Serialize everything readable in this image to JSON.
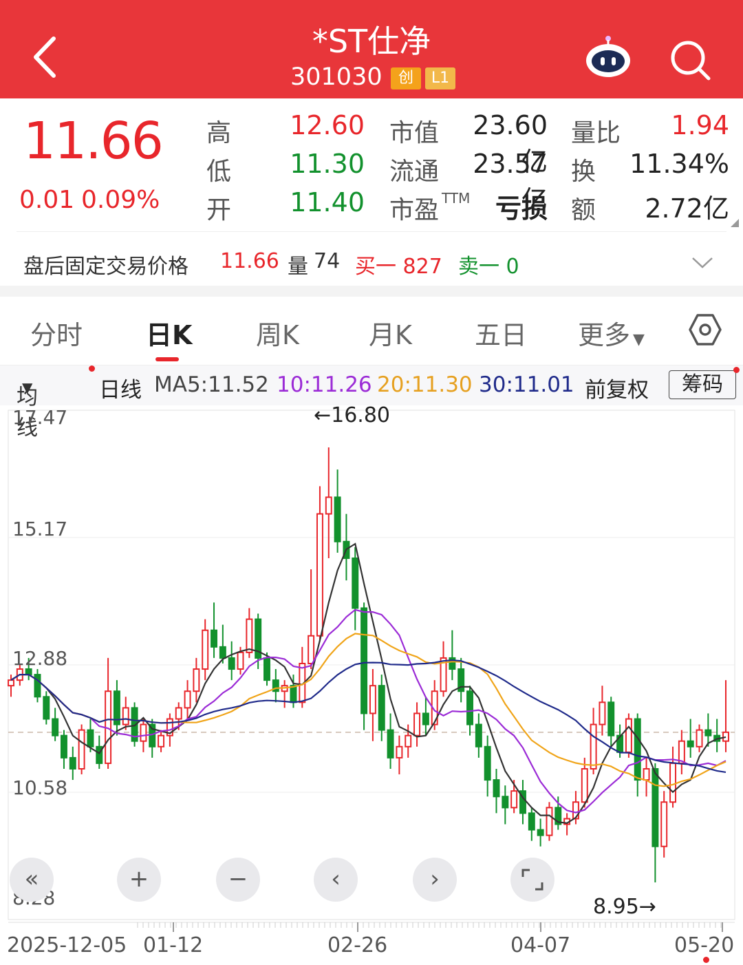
{
  "header": {
    "title": "*ST仕净",
    "code": "301030",
    "badge_1": "创",
    "badge_2": "L1",
    "icons": [
      "back-icon",
      "robot-icon",
      "search-icon"
    ]
  },
  "quote": {
    "price": "11.66",
    "change": "0.01",
    "change_pct": "0.09%",
    "high_label": "高",
    "high": "12.60",
    "low_label": "低",
    "low": "11.30",
    "open_label": "开",
    "open": "11.40",
    "mktcap_label": "市值",
    "mktcap": "23.60亿",
    "float_label": "流通",
    "float": "23.57亿",
    "pe_label": "市盈",
    "pe_sup": "TTM",
    "pe": "亏损",
    "volratio_label": "量比",
    "volratio": "1.94",
    "turnover_label": "换",
    "turnover": "11.34%",
    "amount_label": "额",
    "amount": "2.72亿"
  },
  "post_trade": {
    "label": "盘后固定交易价格",
    "price": "11.66",
    "vol_label": "量",
    "vol": "74",
    "buy": "买一 827",
    "sell": "卖一 0"
  },
  "tabs": [
    "分时",
    "日K",
    "周K",
    "月K",
    "五日",
    "更多"
  ],
  "active_tab": "日K",
  "ma_bar": {
    "indicator": "均线",
    "period": "日线",
    "ma5": "MA5:11.52",
    "ma10": "10:11.26",
    "ma20": "20:11.30",
    "ma30": "30:11.01",
    "adjust": "前复权",
    "chip": "筹码",
    "colors": {
      "ma5": "#333333",
      "ma10": "#9b2bd6",
      "ma20": "#f0a418",
      "ma30": "#1f2a8a",
      "up": "#e8262b",
      "down": "#12912d"
    }
  },
  "chart_data": {
    "type": "candlestick",
    "y_ticks": [
      "17.47",
      "15.17",
      "12.88",
      "10.58",
      "8.28"
    ],
    "ylim": [
      8.28,
      17.47
    ],
    "x_ticks": [
      "2025-12-05",
      "01-12",
      "02-26",
      "04-07",
      "05-20"
    ],
    "last_close_line": 11.66,
    "high_annotation": "←16.80",
    "low_annotation": "8.95→",
    "candles": [
      [
        12.5,
        12.7,
        12.3,
        12.6
      ],
      [
        12.6,
        12.9,
        12.5,
        12.8
      ],
      [
        12.8,
        13.0,
        12.6,
        12.7
      ],
      [
        12.7,
        12.8,
        12.2,
        12.3
      ],
      [
        12.3,
        12.4,
        11.8,
        11.9
      ],
      [
        11.9,
        12.1,
        11.5,
        11.6
      ],
      [
        11.6,
        11.7,
        11.0,
        11.2
      ],
      [
        11.2,
        11.4,
        10.8,
        11.0
      ],
      [
        11.0,
        11.8,
        10.9,
        11.7
      ],
      [
        11.7,
        11.9,
        11.3,
        11.4
      ],
      [
        11.4,
        11.6,
        11.0,
        11.1
      ],
      [
        11.1,
        13.0,
        11.0,
        12.4
      ],
      [
        12.4,
        12.6,
        11.6,
        11.8
      ],
      [
        11.8,
        12.3,
        11.7,
        12.1
      ],
      [
        12.1,
        12.2,
        11.4,
        11.5
      ],
      [
        11.5,
        11.9,
        11.3,
        11.8
      ],
      [
        11.8,
        11.9,
        11.2,
        11.4
      ],
      [
        11.4,
        11.7,
        11.3,
        11.6
      ],
      [
        11.6,
        12.0,
        11.4,
        11.9
      ],
      [
        11.9,
        12.2,
        11.7,
        12.1
      ],
      [
        12.1,
        12.6,
        11.9,
        12.4
      ],
      [
        12.4,
        13.0,
        12.2,
        12.8
      ],
      [
        12.8,
        13.7,
        12.6,
        13.5
      ],
      [
        13.5,
        14.0,
        13.0,
        13.2
      ],
      [
        13.2,
        13.6,
        12.9,
        13.0
      ],
      [
        13.0,
        13.3,
        12.6,
        12.8
      ],
      [
        12.8,
        13.2,
        12.7,
        13.1
      ],
      [
        13.1,
        13.9,
        13.0,
        13.7
      ],
      [
        13.7,
        13.8,
        12.8,
        13.0
      ],
      [
        13.0,
        13.1,
        12.5,
        12.6
      ],
      [
        12.6,
        12.8,
        12.2,
        12.4
      ],
      [
        12.4,
        12.6,
        12.1,
        12.5
      ],
      [
        12.5,
        12.7,
        12.1,
        12.2
      ],
      [
        12.2,
        13.2,
        12.1,
        12.9
      ],
      [
        12.9,
        14.6,
        12.8,
        13.4
      ],
      [
        13.4,
        16.1,
        13.3,
        15.6
      ],
      [
        15.6,
        16.8,
        14.8,
        15.9
      ],
      [
        15.9,
        16.4,
        14.9,
        15.1
      ],
      [
        15.1,
        15.6,
        14.4,
        14.8
      ],
      [
        14.8,
        15.0,
        13.5,
        13.9
      ],
      [
        13.9,
        14.0,
        11.7,
        12.0
      ],
      [
        12.0,
        12.8,
        11.5,
        12.5
      ],
      [
        12.5,
        12.7,
        11.5,
        11.7
      ],
      [
        11.7,
        12.0,
        11.0,
        11.2
      ],
      [
        11.2,
        11.6,
        10.9,
        11.4
      ],
      [
        11.4,
        11.8,
        11.2,
        11.6
      ],
      [
        11.6,
        12.2,
        11.4,
        12.0
      ],
      [
        12.0,
        12.3,
        11.6,
        11.8
      ],
      [
        11.8,
        12.6,
        11.7,
        12.4
      ],
      [
        12.4,
        13.3,
        12.3,
        13.0
      ],
      [
        13.0,
        13.5,
        12.6,
        12.8
      ],
      [
        12.8,
        13.0,
        12.2,
        12.4
      ],
      [
        12.4,
        12.5,
        11.6,
        11.8
      ],
      [
        11.8,
        12.0,
        11.2,
        11.4
      ],
      [
        11.4,
        11.6,
        10.5,
        10.8
      ],
      [
        10.8,
        11.0,
        10.2,
        10.5
      ],
      [
        10.5,
        10.7,
        10.0,
        10.3
      ],
      [
        10.3,
        10.8,
        10.2,
        10.6
      ],
      [
        10.6,
        10.8,
        10.0,
        10.2
      ],
      [
        10.2,
        10.3,
        9.7,
        9.9
      ],
      [
        9.9,
        10.1,
        9.6,
        9.8
      ],
      [
        9.8,
        10.4,
        9.7,
        10.3
      ],
      [
        10.3,
        10.5,
        9.9,
        10.0
      ],
      [
        10.0,
        10.2,
        9.8,
        10.1
      ],
      [
        10.1,
        10.6,
        10.0,
        10.4
      ],
      [
        10.4,
        11.2,
        10.3,
        11.0
      ],
      [
        11.0,
        12.1,
        10.9,
        11.8
      ],
      [
        11.8,
        12.5,
        11.6,
        12.2
      ],
      [
        12.2,
        12.3,
        11.4,
        11.6
      ],
      [
        11.6,
        11.8,
        11.2,
        11.3
      ],
      [
        11.3,
        12.0,
        11.2,
        11.9
      ],
      [
        11.9,
        12.0,
        10.5,
        10.8
      ],
      [
        10.8,
        11.2,
        10.5,
        11.0
      ],
      [
        11.0,
        11.1,
        8.95,
        9.6
      ],
      [
        9.6,
        10.6,
        9.4,
        10.4
      ],
      [
        10.4,
        11.4,
        10.3,
        11.1
      ],
      [
        11.1,
        11.7,
        10.9,
        11.5
      ],
      [
        11.5,
        11.9,
        11.2,
        11.4
      ],
      [
        11.4,
        11.8,
        11.3,
        11.7
      ],
      [
        11.7,
        12.0,
        11.4,
        11.6
      ],
      [
        11.6,
        11.9,
        11.3,
        11.5
      ],
      [
        11.5,
        12.6,
        11.3,
        11.66
      ]
    ]
  },
  "controls": [
    "fast-back",
    "zoom-in",
    "zoom-out",
    "prev",
    "next",
    "fullscreen"
  ]
}
